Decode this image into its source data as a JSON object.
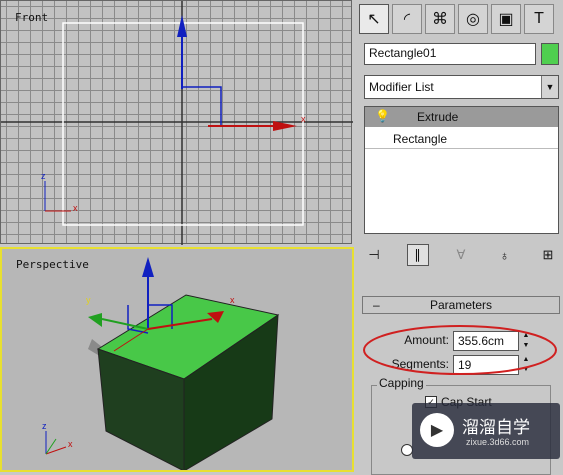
{
  "viewports": {
    "front_label": "Front",
    "perspective_label": "Perspective",
    "axis_x": "x",
    "axis_y": "y",
    "axis_z": "z"
  },
  "panel": {
    "tabs": [
      {
        "name": "create",
        "glyph": "↖"
      },
      {
        "name": "modify",
        "glyph": "◜"
      },
      {
        "name": "hierarchy",
        "glyph": "⌘"
      },
      {
        "name": "motion",
        "glyph": "◎"
      },
      {
        "name": "display",
        "glyph": "▣"
      },
      {
        "name": "utilities",
        "glyph": "T"
      }
    ],
    "object_name": "Rectangle01",
    "object_color": "#4fcf4f",
    "modifier_list": "Modifier List",
    "stack": {
      "selected": "Extrude",
      "base": "Rectangle"
    },
    "parameters": {
      "title": "Parameters",
      "amount_label": "Amount:",
      "amount_value": "355.6cm",
      "segments_label": "Segments:",
      "segments_value": "19",
      "capping_label": "Capping",
      "cap_start_label": "Cap Start"
    }
  },
  "watermark": {
    "title": "溜溜自学",
    "subtitle": "zixue.3d66.com"
  }
}
